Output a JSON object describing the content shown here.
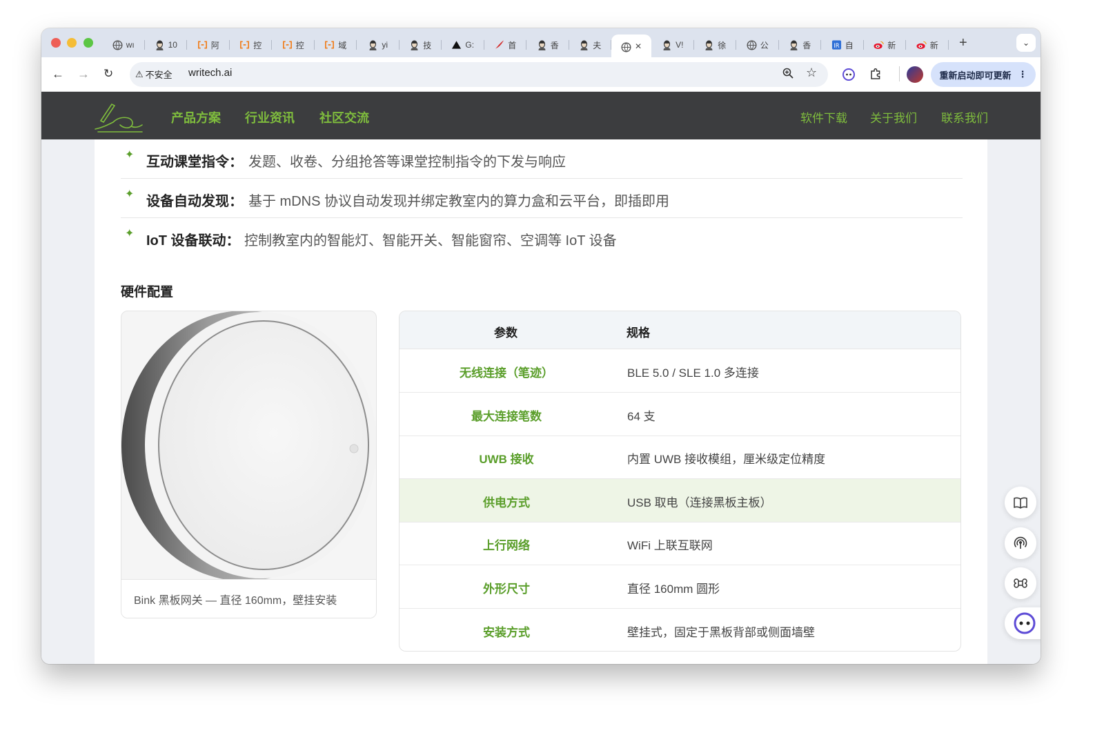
{
  "browser": {
    "tabs": [
      {
        "label": "wı",
        "icon": "globe-icon"
      },
      {
        "label": "10",
        "icon": "avatar-icon"
      },
      {
        "label": "阿",
        "icon": "bracket-icon"
      },
      {
        "label": "控",
        "icon": "bracket-icon"
      },
      {
        "label": "控",
        "icon": "bracket-icon"
      },
      {
        "label": "域",
        "icon": "bracket-icon"
      },
      {
        "label": "yi",
        "icon": "avatar-icon"
      },
      {
        "label": "技",
        "icon": "avatar-icon"
      },
      {
        "label": "G:",
        "icon": "triangle-icon"
      },
      {
        "label": "首",
        "icon": "feather-icon"
      },
      {
        "label": "香",
        "icon": "avatar-icon"
      },
      {
        "label": "夫",
        "icon": "avatar-icon"
      },
      {
        "label": "×",
        "icon": "globe-icon",
        "active": true
      },
      {
        "label": "V!",
        "icon": "avatar-icon"
      },
      {
        "label": "徐",
        "icon": "avatar-icon"
      },
      {
        "label": "公",
        "icon": "globe-icon"
      },
      {
        "label": "香",
        "icon": "avatar-icon"
      },
      {
        "label": "自",
        "icon": "blue-square-icon"
      },
      {
        "label": "新",
        "icon": "weibo-icon"
      },
      {
        "label": "新",
        "icon": "weibo-icon"
      }
    ],
    "security_label": "不安全",
    "url": "writech.ai",
    "update_label": "重新启动即可更新"
  },
  "site": {
    "nav_left": [
      "产品方案",
      "行业资讯",
      "社区交流"
    ],
    "nav_right": [
      "软件下载",
      "关于我们",
      "联系我们"
    ]
  },
  "features": [
    {
      "title": "互动课堂指令：",
      "desc": "发题、收卷、分组抢答等课堂控制指令的下发与响应"
    },
    {
      "title": "设备自动发现：",
      "desc": "基于 mDNS 协议自动发现并绑定教室内的算力盒和云平台，即插即用"
    },
    {
      "title": "IoT 设备联动：",
      "desc": "控制教室内的智能灯、智能开关、智能窗帘、空调等 IoT 设备"
    }
  ],
  "hardware": {
    "title": "硬件配置",
    "image_caption": "Bink 黑板网关 — 直径 160mm，壁挂安装",
    "table_headers": [
      "参数",
      "规格"
    ],
    "rows": [
      {
        "param": "无线连接（笔迹）",
        "spec": "BLE 5.0 / SLE 1.0 多连接"
      },
      {
        "param": "最大连接笔数",
        "spec": "64 支"
      },
      {
        "param": "UWB 接收",
        "spec": "内置 UWB 接收模组，厘米级定位精度"
      },
      {
        "param": "供电方式",
        "spec": "USB 取电（连接黑板主板）",
        "highlighted": true
      },
      {
        "param": "上行网络",
        "spec": "WiFi 上联互联网"
      },
      {
        "param": "外形尺寸",
        "spec": "直径 160mm 圆形"
      },
      {
        "param": "安装方式",
        "spec": "壁挂式，固定于黑板背部或侧面墙壁"
      }
    ]
  },
  "colors": {
    "accent_green": "#7fbd3d",
    "navbar": "#3c3d3f",
    "highlight_row": "#eef5e6"
  }
}
